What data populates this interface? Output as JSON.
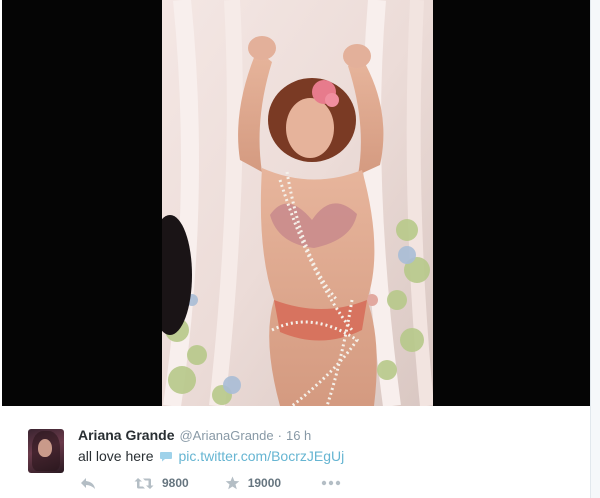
{
  "media": {
    "description_icon": "photo",
    "colors": {
      "background": "#050505"
    }
  },
  "tweet": {
    "author_name": "Ariana Grande",
    "author_handle": "@ArianaGrande",
    "separator": "·",
    "timestamp": "16 h",
    "text": "all love here",
    "link": "pic.twitter.com/BocrzJEgUj",
    "icons": [
      "reply-icon",
      "retweet-icon",
      "favorite-icon",
      "more-icon"
    ],
    "retweet_count": "9800",
    "favorite_count": "19000",
    "colors": {
      "name": "#292f33",
      "muted": "#8899a6",
      "link": "#66b5d2",
      "icon": "#b4bec5"
    }
  }
}
